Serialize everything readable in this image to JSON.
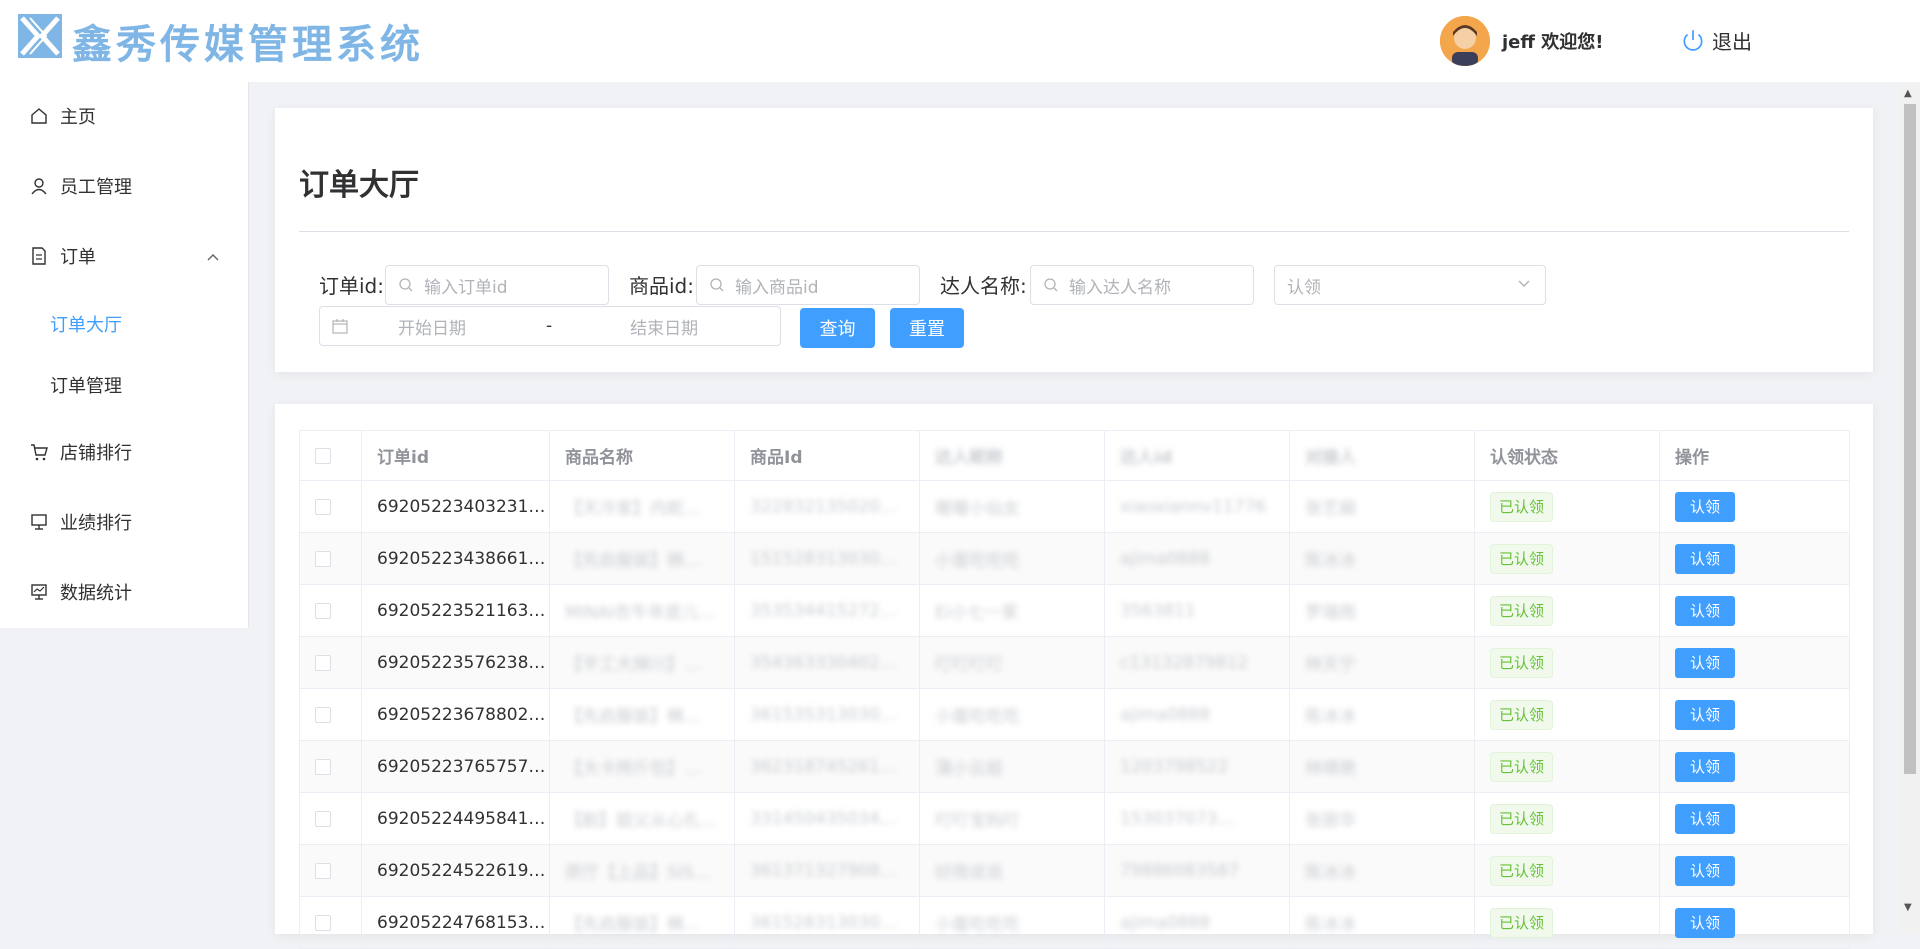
{
  "header": {
    "brand": "鑫秀传媒管理系统",
    "welcome": "jeff 欢迎您!",
    "logout": "退出"
  },
  "sidebar": {
    "items": [
      {
        "label": "主页",
        "icon": "home-icon"
      },
      {
        "label": "员工管理",
        "icon": "user-icon"
      },
      {
        "label": "订单",
        "icon": "document-icon"
      },
      {
        "label": "店铺排行",
        "icon": "cart-icon"
      },
      {
        "label": "业绩排行",
        "icon": "trophy-icon"
      },
      {
        "label": "数据统计",
        "icon": "chart-icon"
      }
    ],
    "submenu": [
      "订单大厅",
      "订单管理"
    ]
  },
  "page": {
    "title": "订单大厅"
  },
  "filters": {
    "order_id_label": "订单id:",
    "order_id_placeholder": "输入订单id",
    "product_id_label": "商品id:",
    "product_id_placeholder": "输入商品id",
    "talent_label": "达人名称:",
    "talent_placeholder": "输入达人名称",
    "claim_select": "认领",
    "start_date": "开始日期",
    "date_sep": "-",
    "end_date": "结束日期",
    "query_btn": "查询",
    "reset_btn": "重置"
  },
  "table": {
    "headers": [
      "订单id",
      "商品名称",
      "商品Id",
      "达人昵称",
      "达人id",
      "对接人",
      "认领状态",
      "操作"
    ],
    "rows": [
      {
        "id": "69205223403231…",
        "name": "【天冷家】内蛇…",
        "pid": "322832135020…",
        "nick": "喔喔小仙女",
        "tid": "xiaoxiannv11776",
        "contact": "张艺娟",
        "status": "已认领",
        "action": "认领"
      },
      {
        "id": "69205223438661…",
        "name": "【先启服装】棉…",
        "pid": "151528313030…",
        "nick": "小蛋吃吃吃",
        "tid": "ajima0888",
        "contact": "陈冰冰",
        "status": "已认领",
        "action": "认领"
      },
      {
        "id": "69205223521163…",
        "name": "MINAI衣牛年皮儿…",
        "pid": "353534415272…",
        "nick": "Ei小七一家",
        "tid": "3563811",
        "contact": "罗瑞雨",
        "status": "已认领",
        "action": "认领"
      },
      {
        "id": "69205223576238…",
        "name": "【平工大婶川】…",
        "pid": "354363330402…",
        "nick": "叮叮叮叮",
        "tid": "c13132879812",
        "contact": "林天宁",
        "status": "已认领",
        "action": "认领"
      },
      {
        "id": "69205223678802…",
        "name": "【先启服装】棉…",
        "pid": "361535313030…",
        "nick": "小蛋吃吃吃",
        "tid": "ajima0888",
        "contact": "陈冰冰",
        "status": "已认领",
        "action": "认领"
      },
      {
        "id": "69205223765757…",
        "name": "【大卡挎斤包】…",
        "pid": "362318745261…",
        "nick": "蒲小云姐",
        "tid": "1203798522",
        "contact": "林晴艳",
        "status": "已认领",
        "action": "认领"
      },
      {
        "id": "69205224495841…",
        "name": "【剧】姐父从心扎…",
        "pid": "331450435034…",
        "nick": "叮叮宝妈叮",
        "tid": "153037073…",
        "contact": "张丽华",
        "status": "已认领",
        "action": "认领"
      },
      {
        "id": "69205224522619…",
        "name": "原厅【上品】SIS…",
        "pid": "361371327908…",
        "nick": "好雨说说",
        "tid": "79886083587",
        "contact": "陈冰冰",
        "status": "已认领",
        "action": "认领"
      },
      {
        "id": "69205224768153…",
        "name": "【先启服装】棉…",
        "pid": "361528313030…",
        "nick": "小蛋吃吃吃",
        "tid": "ajima0888",
        "contact": "陈冰冰",
        "status": "已认领",
        "action": "认领"
      }
    ]
  },
  "colors": {
    "accent": "#409eff",
    "brand": "#7fb6e6",
    "success": "#67c23a"
  }
}
